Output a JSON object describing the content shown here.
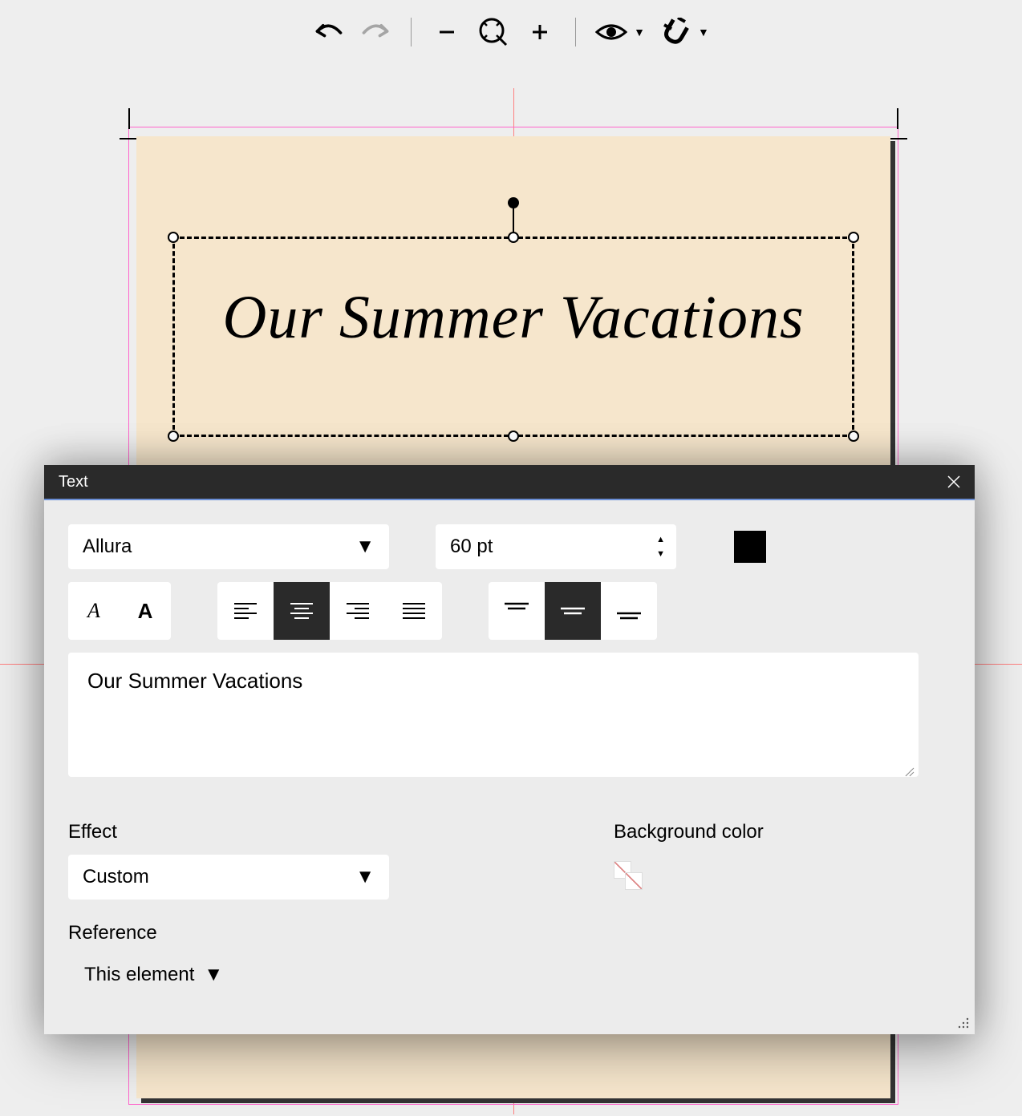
{
  "toolbar": {
    "undo": "undo",
    "redo": "redo",
    "zoom_out": "−",
    "zoom_in": "+"
  },
  "canvas": {
    "text_content": "Our Summer Vacations"
  },
  "panel": {
    "title": "Text",
    "font_name": "Allura",
    "font_size": "60 pt",
    "text_value": "Our Summer Vacations",
    "effect_label": "Effect",
    "effect_value": "Custom",
    "bg_label": "Background color",
    "ref_label": "Reference",
    "ref_value": "This element",
    "color": "#000000"
  }
}
